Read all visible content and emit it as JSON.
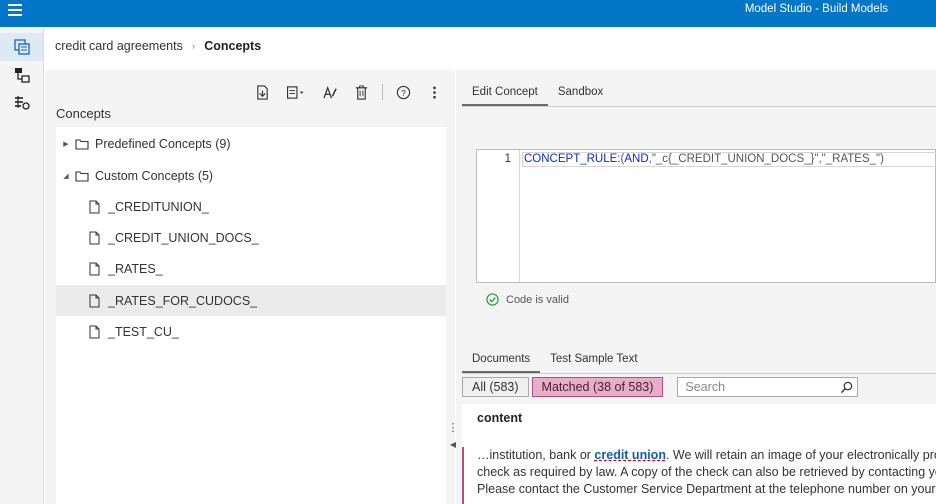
{
  "app": {
    "title": "Model Studio - Build Models",
    "menu_icon": "hamburger-menu-icon"
  },
  "rail": {
    "items": [
      {
        "icon": "concepts-icon",
        "active": true
      },
      {
        "icon": "pipeline-icon",
        "active": false
      },
      {
        "icon": "data-rules-icon",
        "active": false
      }
    ]
  },
  "breadcrumb": {
    "parent": "credit card agreements",
    "separator": "›",
    "current": "Concepts"
  },
  "left_panel": {
    "title": "Concepts",
    "toolbar": [
      "import-icon",
      "add-dropdown-icon",
      "rename-icon",
      "delete-icon",
      "help-icon",
      "more-options-icon"
    ],
    "tree": {
      "predefined": {
        "label": "Predefined Concepts (9)",
        "expanded": false
      },
      "custom": {
        "label": "Custom Concepts (5)",
        "expanded": true
      },
      "items": [
        {
          "label": "_CREDITUNION_"
        },
        {
          "label": "_CREDIT_UNION_DOCS_"
        },
        {
          "label": "_RATES_"
        },
        {
          "label": "_RATES_FOR_CUDOCS_",
          "selected": true
        },
        {
          "label": "_TEST_CU_"
        }
      ]
    }
  },
  "editor": {
    "tabs": [
      "Edit Concept",
      "Sandbox"
    ],
    "active_tab": "Edit Concept",
    "line_number": "1",
    "code": {
      "kw1": "CONCEPT_RULE:",
      "p1": "(",
      "kw2": "AND",
      "rest": ",\"_c{_CREDIT_UNION_DOCS_}\",\"_RATES_\")"
    },
    "status": "Code is valid",
    "status_color": "#2e9b3a"
  },
  "results": {
    "tabs": [
      "Documents",
      "Test Sample Text"
    ],
    "active_tab": "Documents",
    "filter_all": "All (583)",
    "filter_matched": "Matched (38 of 583)",
    "search_placeholder": "Search",
    "column_header": "content",
    "line1_pre": "…institution, bank or ",
    "line1_match": "credit union",
    "line1_post": ". We will retain an image of your electronically proc",
    "line2": "check as required by law. A copy of the check can also be retrieved by contacting you",
    "line3": "Please contact the Customer Service Department at the telephone number on your I"
  },
  "colors": {
    "topbar": "#0476c8",
    "matched_bg": "#e8aec8",
    "matched_border": "#b04e7c",
    "keyword": "#0b2bd1",
    "match_link": "#0b5fb5"
  }
}
